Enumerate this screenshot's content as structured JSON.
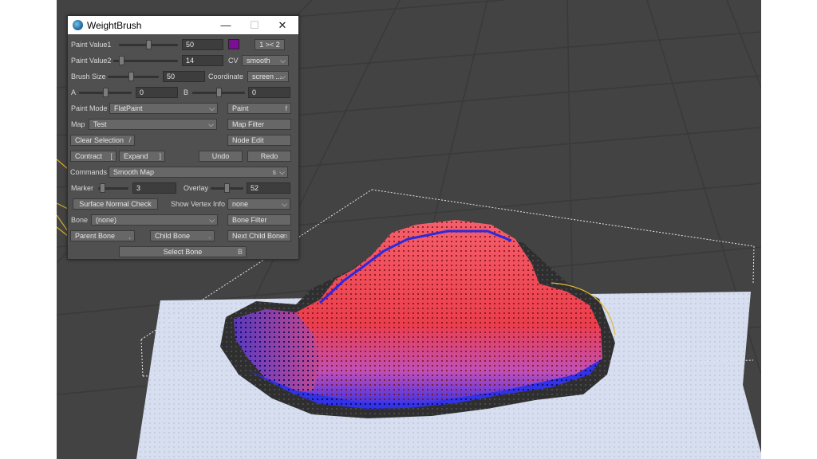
{
  "window": {
    "title": "WeightBrush",
    "minimize": "—",
    "maximize": "☐",
    "close": "✕"
  },
  "colors": {
    "viewport_bg": "#434343",
    "panel_bg": "#505050",
    "paint_swatch": "#7a0f95",
    "mesh_red": "#ee3a46",
    "mesh_blue": "#2a2ae0",
    "ground": "#d7def0"
  },
  "paint_value1": {
    "label": "Paint Value1",
    "value": "50",
    "slider_fraction": 0.5,
    "swap_button": "1 >< 2"
  },
  "paint_value2": {
    "label": "Paint Value2",
    "value": "14",
    "slider_fraction": 0.1,
    "cv_label": "CV",
    "cv_value": "smooth"
  },
  "brush_size": {
    "label": "Brush Size",
    "value": "50",
    "slider_fraction": 0.45,
    "coordinate_label": "Coordinate",
    "coordinate_value": "screen ..."
  },
  "a_row": {
    "label": "A",
    "value": "0",
    "slider_fraction": 0.5
  },
  "b_row": {
    "label": "B",
    "value": "0",
    "slider_fraction": 0.5
  },
  "paint_mode": {
    "label": "Paint Mode",
    "value": "FlatPaint",
    "paint_button": "Paint",
    "paint_key": "f"
  },
  "map": {
    "label": "Map",
    "value": "Test",
    "map_filter_button": "Map Filter"
  },
  "clear_selection": {
    "label": "Clear Selection",
    "key": "/",
    "node_edit_button": "Node Edit"
  },
  "contract": {
    "label": "Contract",
    "key": "["
  },
  "expand": {
    "label": "Expand",
    "key": "]"
  },
  "undo": {
    "label": "Undo"
  },
  "redo": {
    "label": "Redo"
  },
  "commands": {
    "label": "Commands",
    "value": "Smooth Map",
    "key": "s"
  },
  "marker": {
    "label": "Marker",
    "value": "3",
    "slider_fraction": 0.05
  },
  "overlay": {
    "label": "Overlay",
    "value": "52",
    "slider_fraction": 0.5
  },
  "surface_normal_check": {
    "label": "Surface Normal Check"
  },
  "show_vertex_info": {
    "label": "Show Vertex Info",
    "value": "none"
  },
  "bone": {
    "label": "Bone",
    "value": "(none)",
    "bone_filter_button": "Bone Filter"
  },
  "parent_bone": {
    "label": "Parent Bone",
    "key": ","
  },
  "child_bone": {
    "label": "Child Bone",
    "key": "."
  },
  "next_child_bone": {
    "label": "Next Child Bone",
    "key": "n"
  },
  "select_bone": {
    "label": "Select Bone",
    "key": "B"
  }
}
